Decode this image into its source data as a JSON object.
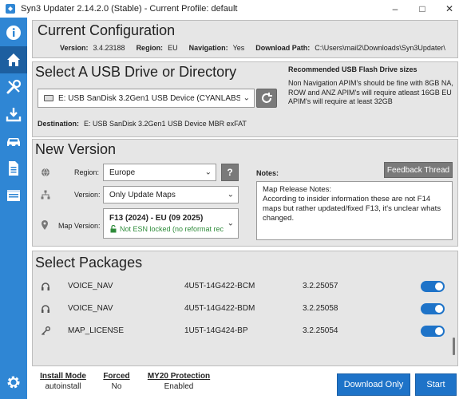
{
  "window": {
    "title": "Syn3 Updater 2.14.2.0 (Stable) - Current Profile: default",
    "controls": [
      "minimize",
      "maximize",
      "close"
    ]
  },
  "sidebar": {
    "items": [
      {
        "name": "info",
        "icon": "info-icon",
        "active": false
      },
      {
        "name": "home",
        "icon": "home-icon",
        "active": true
      },
      {
        "name": "tools",
        "icon": "tools-icon",
        "active": false
      },
      {
        "name": "download",
        "icon": "download-icon",
        "active": false
      },
      {
        "name": "car",
        "icon": "car-icon",
        "active": false
      },
      {
        "name": "log",
        "icon": "document-icon",
        "active": false
      },
      {
        "name": "browser",
        "icon": "browser-icon",
        "active": false
      },
      {
        "name": "settings",
        "icon": "gear-icon",
        "active": false
      }
    ]
  },
  "current_config": {
    "title": "Current Configuration",
    "version_label": "Version:",
    "version_value": "3.4.23188",
    "region_label": "Region:",
    "region_value": "EU",
    "navigation_label": "Navigation:",
    "navigation_value": "Yes",
    "download_path_label": "Download Path:",
    "download_path_value": "C:\\Users\\mail2\\Downloads\\Syn3Updater\\"
  },
  "usb": {
    "title": "Select A USB Drive or Directory",
    "selected_drive": "E:  USB  SanDisk 3.2Gen1 USB Device (CYANLABS",
    "destination_label": "Destination:",
    "destination_value": "E:  USB  SanDisk 3.2Gen1 USB Device  MBR exFAT",
    "recommended_title": "Recommended USB Flash Drive sizes",
    "recommended_text": "Non Navigation APIM's should be fine with 8GB NA, ROW and ANZ APIM's will require atleast 16GB EU APIM's will require at least 32GB"
  },
  "new_version": {
    "title": "New Version",
    "region_label": "Region:",
    "region_value": "Europe",
    "help_label": "?",
    "version_label": "Version:",
    "version_value": "Only Update Maps",
    "map_version_label": "Map Version:",
    "map_version_value": "F13 (2024) - EU (09 2025)",
    "map_version_sub": "Not ESN locked (no reformat rec",
    "notes_label": "Notes:",
    "feedback_label": "Feedback Thread",
    "notes_text": "Map Release Notes:\nAccording to insider information these are not F14 maps but rather updated/fixed F13, it's unclear whats changed."
  },
  "packages": {
    "title": "Select Packages",
    "rows": [
      {
        "icon": "headset-icon",
        "name": "VOICE_NAV",
        "part": "4U5T-14G422-BCM",
        "version": "3.2.25057",
        "enabled": true
      },
      {
        "icon": "headset-icon",
        "name": "VOICE_NAV",
        "part": "4U5T-14G422-BDM",
        "version": "3.2.25058",
        "enabled": true
      },
      {
        "icon": "key-icon",
        "name": "MAP_LICENSE",
        "part": "1U5T-14G424-BP",
        "version": "3.2.25054",
        "enabled": true
      }
    ]
  },
  "footer": {
    "install_mode_label": "Install Mode",
    "install_mode_value": "autoinstall",
    "forced_label": "Forced",
    "forced_value": "No",
    "my20_label": "MY20 Protection",
    "my20_value": "Enabled",
    "download_only_label": "Download Only",
    "start_label": "Start"
  },
  "colors": {
    "sidebar": "#2f86d4",
    "sidebar_active": "#1d5fa0",
    "panel": "#e6e6e6",
    "accent": "#1e73c8",
    "ok_green": "#2e8b3a"
  }
}
